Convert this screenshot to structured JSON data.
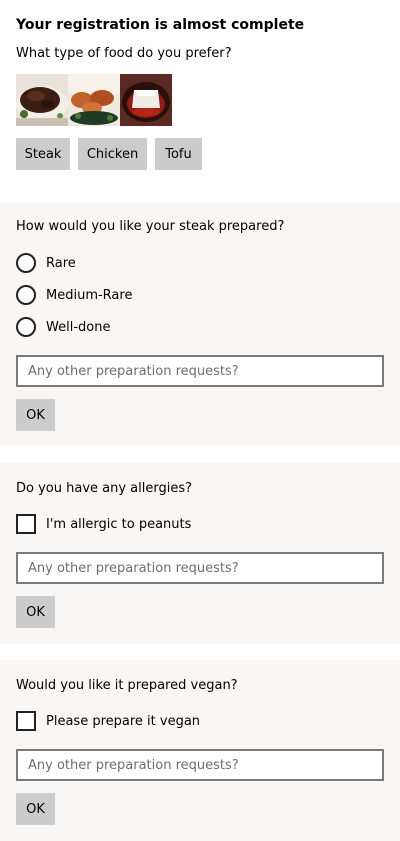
{
  "header": {
    "title": "Your registration is almost complete",
    "food_question": "What type of food do you prefer?"
  },
  "food_options": [
    {
      "label": "Steak",
      "image": "steak-photo"
    },
    {
      "label": "Chicken",
      "image": "chicken-photo"
    },
    {
      "label": "Tofu",
      "image": "tofu-photo"
    }
  ],
  "steak_section": {
    "question": "How would you like your steak prepared?",
    "options": [
      "Rare",
      "Medium-Rare",
      "Well-done"
    ],
    "placeholder": "Any other preparation requests?",
    "ok_label": "OK"
  },
  "allergy_section": {
    "question": "Do you have any allergies?",
    "checkbox_label": "I'm allergic to peanuts",
    "placeholder": "Any other preparation requests?",
    "ok_label": "OK"
  },
  "vegan_section": {
    "question": "Would you like it prepared vegan?",
    "checkbox_label": "Please prepare it vegan",
    "placeholder": "Any other preparation requests?",
    "ok_label": "OK"
  },
  "colors": {
    "card_background": "#f8f7f6",
    "button_background": "#cccccc",
    "input_border": "#7a7a7a"
  }
}
